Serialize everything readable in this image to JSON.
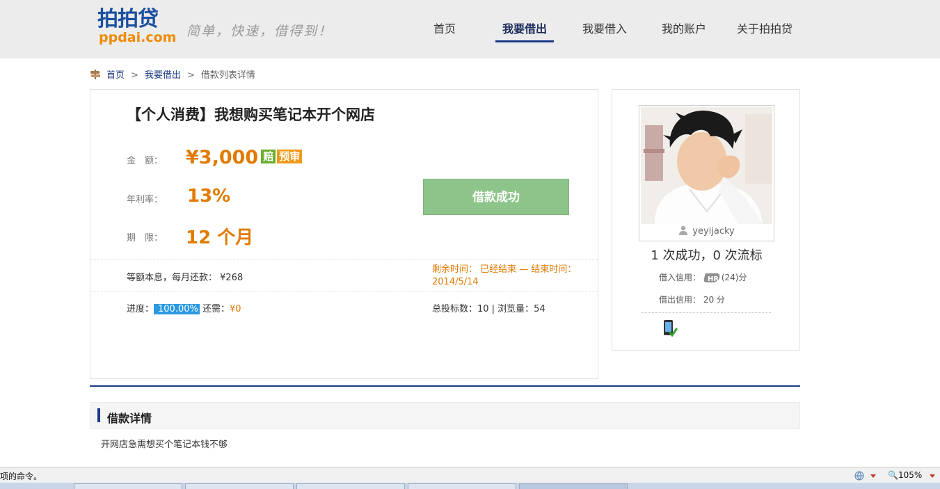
{
  "header": {
    "logo_cn": "拍拍贷",
    "logo_en": "ppdai.com",
    "slogan": "简单，快速，借得到！",
    "nav": [
      {
        "label": "首页",
        "active": false
      },
      {
        "label": "我要借出",
        "active": true
      },
      {
        "label": "我要借入",
        "active": false
      },
      {
        "label": "我的账户",
        "active": false
      },
      {
        "label": "关于拍拍贷",
        "active": false
      }
    ]
  },
  "breadcrumb": {
    "home": "首页",
    "section": "我要借出",
    "current": "借款列表详情",
    "sep": ">"
  },
  "loan": {
    "title": "【个人消费】我想购买笔记本开个网店",
    "amount_label": "金　额：",
    "amount": "¥3,000",
    "badge_compensate": "赔",
    "badge_prereview": "预审",
    "rate_label": "年利率：",
    "rate": "13%",
    "term_label": "期　限：",
    "term": "12 个月",
    "status_button": "借款成功",
    "repay_info": "等额本息，每月还款： ¥268",
    "remain_text": "剩余时间： 已经结束 — 结束时间： 2014/5/14",
    "progress_label": "进度：",
    "progress_pct": "100.00%",
    "progress_value": 1.0,
    "need_label": "还需：",
    "need_value": "¥0",
    "stats": "总投标数：10 | 浏览量：54"
  },
  "borrower": {
    "username": "yeyijacky",
    "record": "1 次成功，0 次流标",
    "borrow_credit_label": "借入信用：",
    "borrow_credit_grade": "HR",
    "borrow_credit_score": "(24)分",
    "lend_credit_label": "借出信用：",
    "lend_credit_value": "20 分",
    "verified_icon": "phone-verified-icon"
  },
  "details": {
    "heading": "借款详情",
    "body": "开网店急需想买个笔记本钱不够"
  },
  "statusbar": {
    "message": "项的命令。",
    "zoom": "105%"
  },
  "colors": {
    "brand_blue": "#1b3a86",
    "orange": "#e07b00",
    "success_green": "#8dc48a",
    "progress_blue": "#2a9ae0"
  }
}
